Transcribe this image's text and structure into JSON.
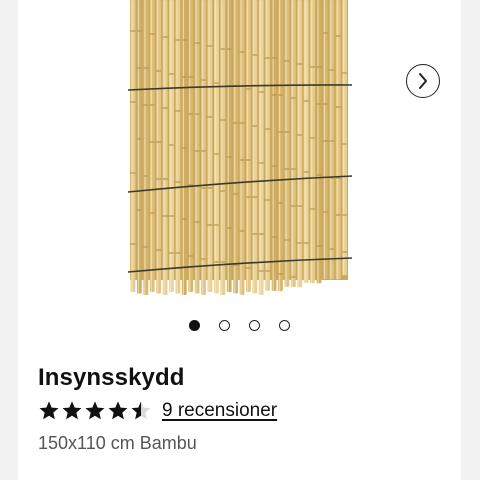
{
  "product": {
    "title": "Insynsskydd",
    "rating": 4.5,
    "rating_max": 5,
    "reviews_label": "9 recensioner",
    "subtitle": "150x110 cm Bambu"
  },
  "carousel": {
    "image_count": 4,
    "active_index": 0,
    "next_icon": "chevron-right-icon"
  },
  "colors": {
    "page_background": "#f2f2f2",
    "card_background": "#ffffff",
    "text_primary": "#111111",
    "text_secondary": "#555555",
    "bamboo": "#e3c98a",
    "wire": "#3b3a2a"
  }
}
